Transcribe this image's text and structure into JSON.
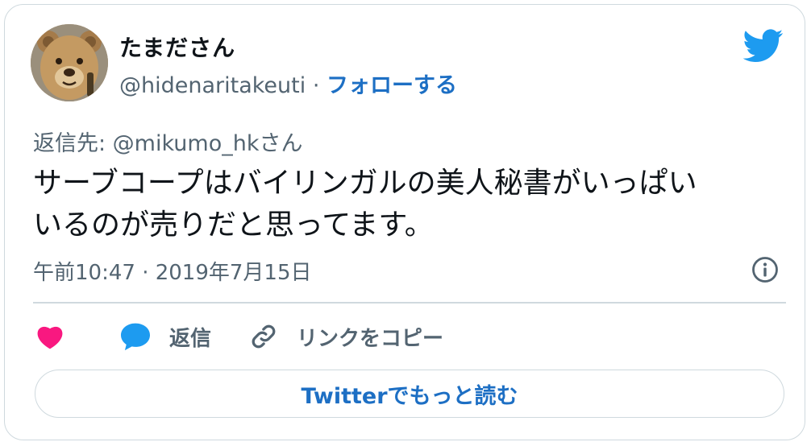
{
  "author": {
    "display_name": "たまださん",
    "handle": "@hidenaritakeuti",
    "separator": "·",
    "follow_label": "フォローする"
  },
  "tweet": {
    "reply_to_label": "返信先: @mikumo_hkさん",
    "text_line1": "サーブコープはバイリンガルの美人秘書がいっぱい",
    "text_line2": "いるのが売りだと思ってます。",
    "timestamp": "午前10:47 · 2019年7月15日"
  },
  "actions": {
    "reply_label": "返信",
    "copy_link_label": "リンクをコピー"
  },
  "footer": {
    "read_more_label": "Twitterでもっと読む"
  },
  "colors": {
    "like": "#f91880",
    "reply": "#1d9bf0",
    "brand": "#1d9bf0",
    "link": "#1d6fc4"
  },
  "icons": [
    "twitter-bird-icon",
    "info-icon",
    "heart-icon",
    "reply-bubble-icon",
    "link-icon"
  ]
}
